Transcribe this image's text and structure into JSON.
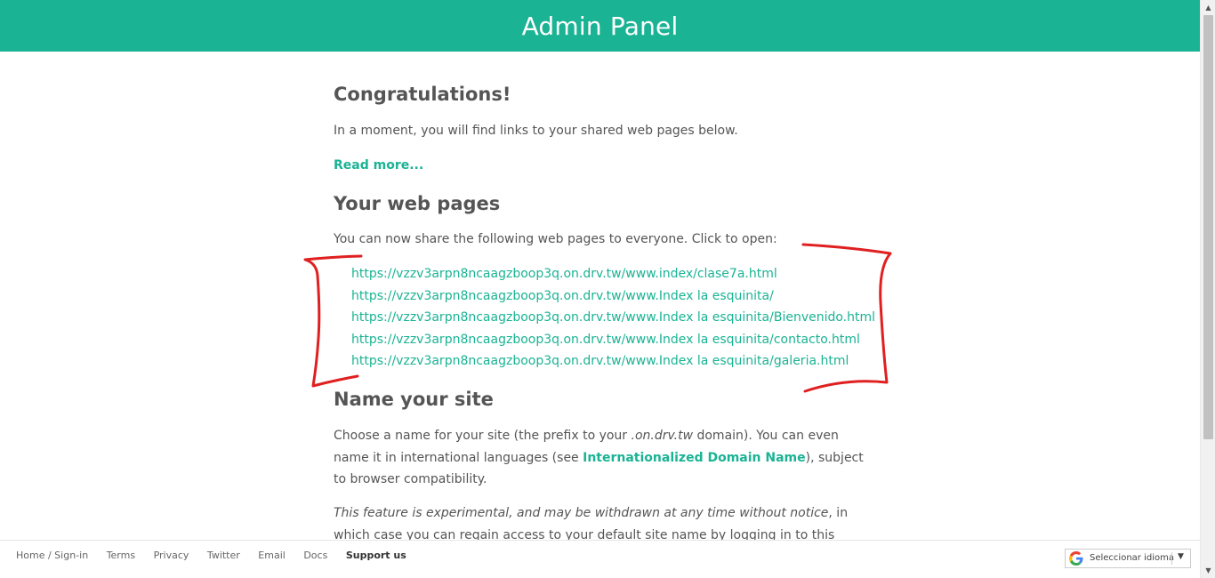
{
  "header": {
    "title": "Admin Panel"
  },
  "congrats": {
    "heading": "Congratulations!",
    "text": "In a moment, you will find links to your shared web pages below.",
    "read_more": "Read more..."
  },
  "web_pages": {
    "heading": "Your web pages",
    "intro": "You can now share the following web pages to everyone. Click to open:",
    "links": [
      "https://vzzv3arpn8ncaagzboop3q.on.drv.tw/www.index/clase7a.html",
      "https://vzzv3arpn8ncaagzboop3q.on.drv.tw/www.Index la esquinita/",
      "https://vzzv3arpn8ncaagzboop3q.on.drv.tw/www.Index la esquinita/Bienvenido.html",
      "https://vzzv3arpn8ncaagzboop3q.on.drv.tw/www.Index la esquinita/contacto.html",
      "https://vzzv3arpn8ncaagzboop3q.on.drv.tw/www.Index la esquinita/galeria.html"
    ]
  },
  "name_site": {
    "heading": "Name your site",
    "p1_a": "Choose a name for your site (the prefix to your ",
    "p1_domain": ".on.drv.tw",
    "p1_b": " domain). You can even name it in international languages (see ",
    "p1_link": "Internationalized Domain Name",
    "p1_c": "), subject to browser compatibility.",
    "p2_italic": "This feature is experimental, and may be withdrawn at any time without notice",
    "p2_rest": ", in which case you can regain access to your default site name by logging in to this Admin Panel."
  },
  "footer": {
    "links": [
      "Home / Sign-in",
      "Terms",
      "Privacy",
      "Twitter",
      "Email",
      "Docs"
    ],
    "support": "Support us"
  },
  "translate": {
    "label": "Seleccionar idioma",
    "arrow": "▼"
  },
  "colors": {
    "accent": "#1ab394",
    "annotation": "#e02020"
  }
}
